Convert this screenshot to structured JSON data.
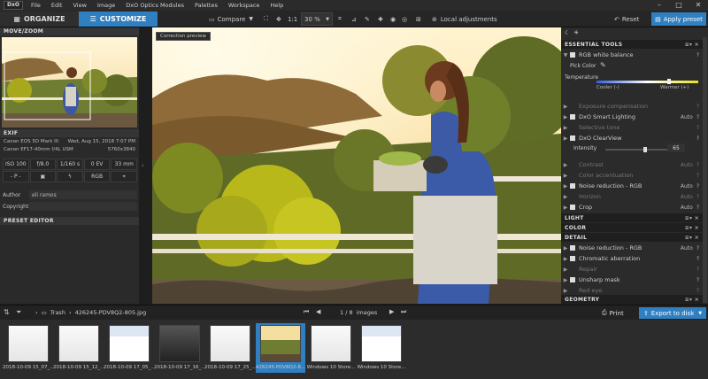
{
  "app": {
    "logo_text": "DxO"
  },
  "menu": [
    "File",
    "Edit",
    "View",
    "Image",
    "DxO Optics Modules",
    "Palettes",
    "Workspace",
    "Help"
  ],
  "tabs": {
    "organize": "ORGANIZE",
    "customize": "CUSTOMIZE"
  },
  "toolbar": {
    "compare": "Compare",
    "zoom_1to1": "1:1",
    "zoom_level": "30 %",
    "local_adjustments": "Local adjustments",
    "reset": "Reset",
    "apply_preset": "Apply preset"
  },
  "left": {
    "move_zoom_title": "MOVE/ZOOM",
    "exif_title": "EXIF",
    "camera": "Canon EOS 5D Mark III",
    "date": "Wed, Aug 15, 2018 7:07 PM",
    "lens": "Canon EF17-40mm f/4L USM",
    "dimensions": "5760x3840",
    "iso": "ISO 100",
    "aperture": "f/8.0",
    "shutter": "1/160 s",
    "ev": "0 EV",
    "focal": "33 mm",
    "mode": "- P -",
    "colorspace": "RGB",
    "author_label": "Author",
    "author_value": "eli ramos",
    "copyright_label": "Copyright",
    "preset_editor_title": "PRESET EDITOR"
  },
  "center": {
    "preview_label": "Correction preview"
  },
  "right": {
    "essential_tools": "ESSENTIAL TOOLS",
    "rgb_white_balance": "RGB white balance",
    "pick_color": "Pick Color",
    "temperature": "Temperature",
    "cooler": "Cooler (-)",
    "warmer": "Warmer (+)",
    "temperature_level": 0.72,
    "tools": [
      {
        "label": "Exposure compensation",
        "value": "",
        "dim": true,
        "checkbox": false
      },
      {
        "label": "DxO Smart Lighting",
        "value": "Auto",
        "dim": false,
        "checkbox": true
      },
      {
        "label": "Selective tone",
        "value": "",
        "dim": true,
        "checkbox": false
      },
      {
        "label": "DxO ClearView",
        "value": "",
        "dim": false,
        "checkbox": true
      }
    ],
    "intensity_label": "Intensity",
    "intensity_value": "65",
    "intensity_level": 0.65,
    "tools2": [
      {
        "label": "Contrast",
        "value": "Auto",
        "dim": true,
        "checkbox": false
      },
      {
        "label": "Color accentuation",
        "value": "",
        "dim": true,
        "checkbox": false
      },
      {
        "label": "Noise reduction - RGB",
        "value": "Auto",
        "dim": false,
        "checkbox": true
      },
      {
        "label": "Horizon",
        "value": "Auto",
        "dim": true,
        "checkbox": false
      },
      {
        "label": "Crop",
        "value": "Auto",
        "dim": false,
        "checkbox": true
      }
    ],
    "light": "LIGHT",
    "color": "COLOR",
    "detail": "DETAIL",
    "detail_tools": [
      {
        "label": "Noise reduction - RGB",
        "value": "Auto",
        "dim": false,
        "checkbox": true
      },
      {
        "label": "Chromatic aberration",
        "value": "",
        "dim": false,
        "checkbox": true
      },
      {
        "label": "Repair",
        "value": "",
        "dim": true,
        "checkbox": false
      },
      {
        "label": "Unsharp mask",
        "value": "",
        "dim": false,
        "checkbox": true
      },
      {
        "label": "Red eye",
        "value": "",
        "dim": true,
        "checkbox": false
      }
    ],
    "geometry": "GEOMETRY"
  },
  "filmstrip": {
    "breadcrumb": "Trash",
    "filename": "426245-PDV8Q2-805.jpg",
    "page": "1 / 8",
    "page_unit": "images",
    "print": "Print",
    "export": "Export to disk",
    "thumbs": [
      {
        "caption": "2018-10-09 15_07_...",
        "kind": "doc"
      },
      {
        "caption": "2018-10-09 15_12_...",
        "kind": "doc"
      },
      {
        "caption": "2018-10-09 17_05_...",
        "kind": "blue"
      },
      {
        "caption": "2018-10-09 17_16_...",
        "kind": "dark"
      },
      {
        "caption": "2018-10-09 17_25_...",
        "kind": "doc"
      },
      {
        "caption": "426245-PDV8Q2-8...",
        "kind": "photo",
        "selected": true
      },
      {
        "caption": "Windows 10 Store...",
        "kind": "doc"
      },
      {
        "caption": "Windows 10 Store...",
        "kind": "blue"
      }
    ]
  }
}
